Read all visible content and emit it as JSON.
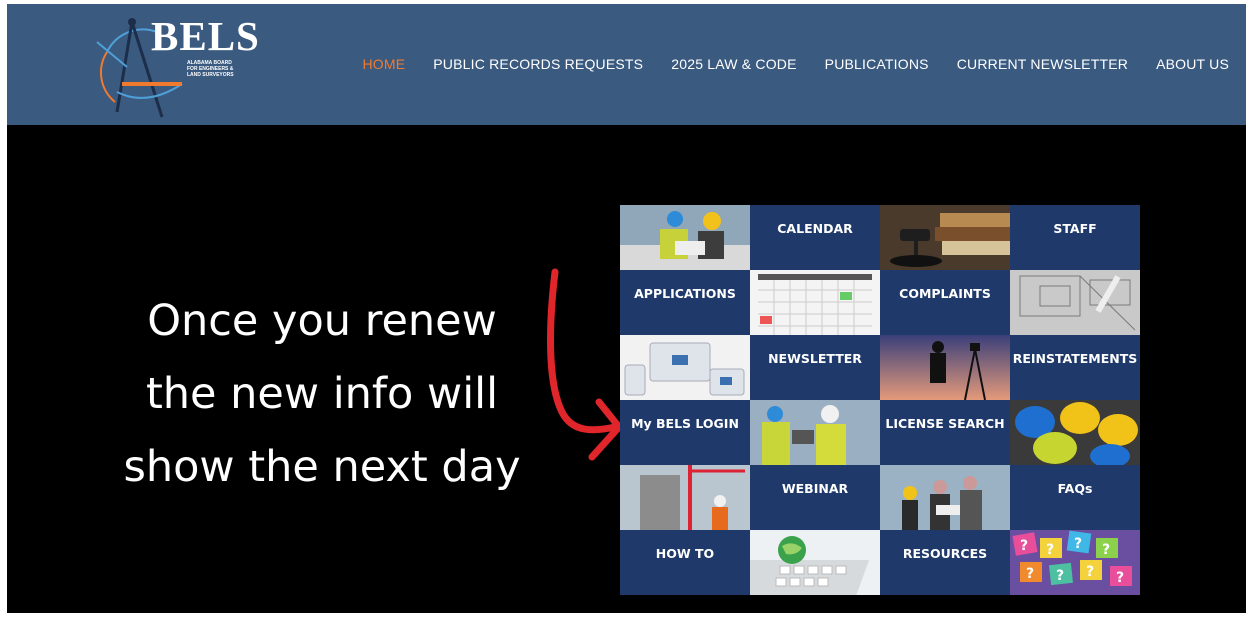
{
  "logo": {
    "name": "BELS",
    "subtitle_lines": [
      "ALABAMA BOARD",
      "FOR ENGINEERS &",
      "LAND SURVEYORS"
    ]
  },
  "nav": {
    "items": [
      {
        "label": "HOME",
        "active": true
      },
      {
        "label": "PUBLIC RECORDS REQUESTS",
        "active": false
      },
      {
        "label": "2025 LAW & CODE",
        "active": false
      },
      {
        "label": "PUBLICATIONS",
        "active": false
      },
      {
        "label": "CURRENT NEWSLETTER",
        "active": false
      },
      {
        "label": "ABOUT US",
        "active": false
      }
    ]
  },
  "message": {
    "lines": [
      "Once you renew",
      "the new info will",
      "show the next day"
    ]
  },
  "tiles": {
    "calendar": "CALENDAR",
    "staff": "STAFF",
    "applications": "APPLICATIONS",
    "complaints": "COMPLAINTS",
    "newsletter": "NEWSLETTER",
    "reinstatements": "REINSTATEMENTS",
    "login": "My BELS LOGIN",
    "license_search": "LICENSE SEARCH",
    "webinar": "WEBINAR",
    "faqs": "FAQs",
    "how_to": "HOW TO",
    "resources": "RESOURCES"
  },
  "colors": {
    "header": "#3a5a80",
    "tile": "#1f3a6a",
    "active_nav": "#f07a2e",
    "arrow": "#e0262b"
  }
}
